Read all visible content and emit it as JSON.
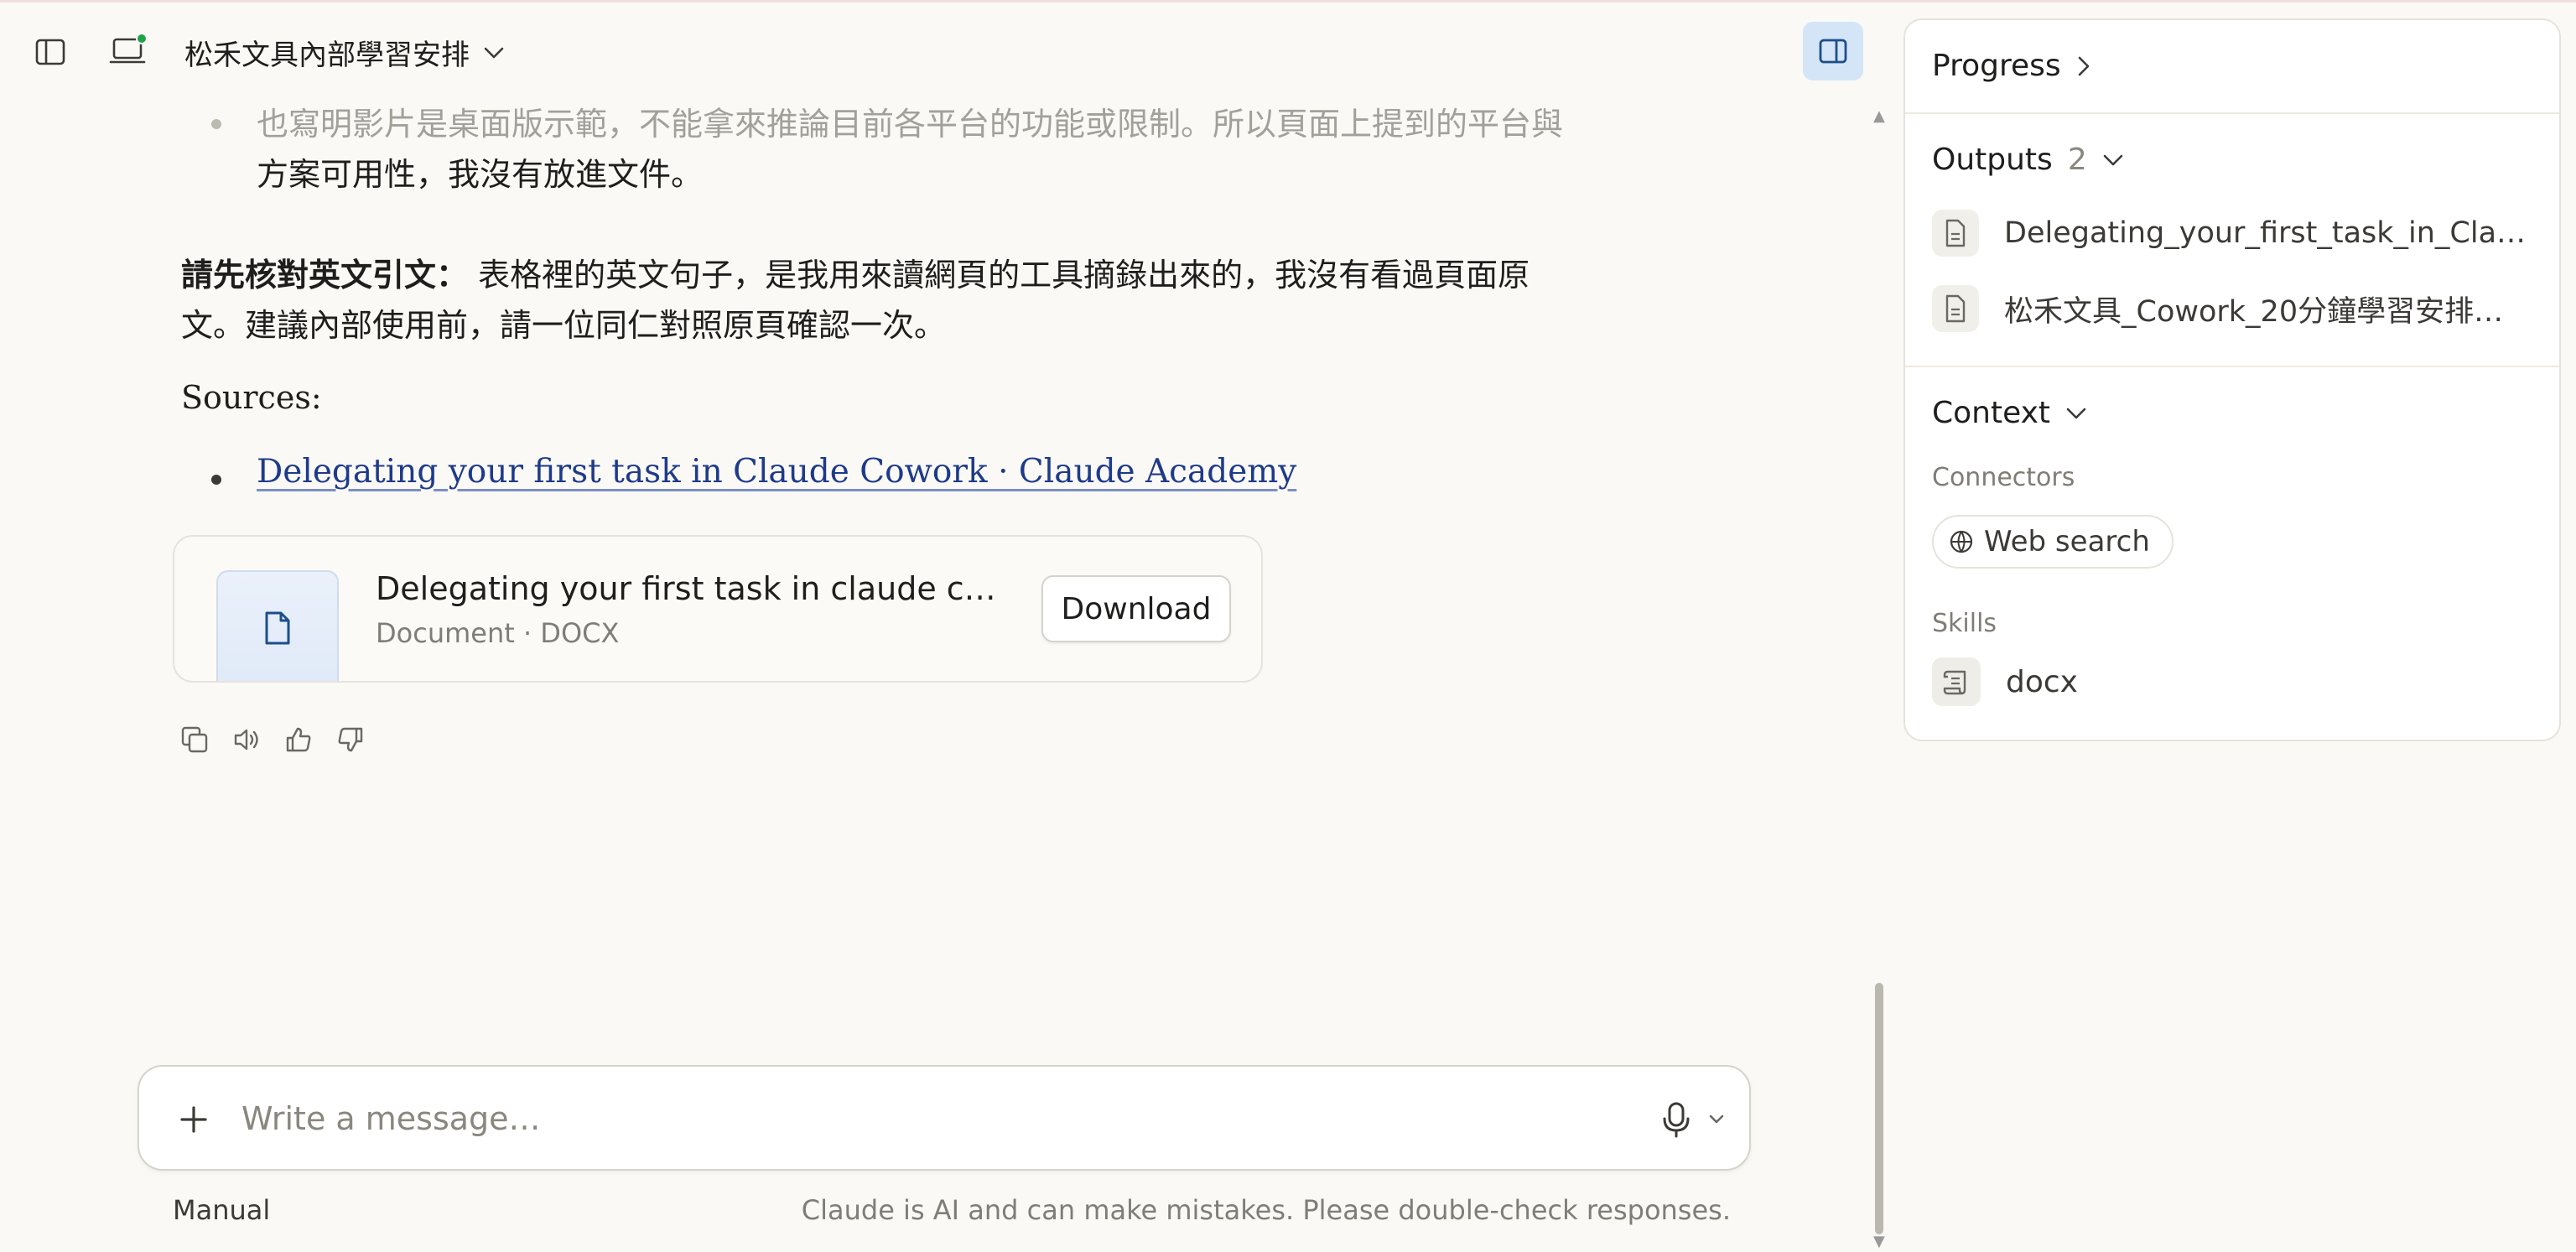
{
  "header": {
    "title": "松禾文具內部學習安排"
  },
  "message": {
    "bullet_prev": "也寫明影片是桌面版示範，不能拿來推論目前各平台的功能或限制。所以頁面上提到的平台與",
    "bullet_prev_cont": "方案可用性，我沒有放進文件。",
    "verify_bold": "請先核對英文引文：",
    "verify_text_line1": "表格裡的英文句子，是我用來讀網頁的工具摘錄出來的，我沒有看過頁面原",
    "verify_text_line2": "文。建議內部使用前，請一位同仁對照原頁確認一次。",
    "sources_label": "Sources:",
    "source_link": "Delegating your first task in Claude Cowork · Claude Academy"
  },
  "file_card": {
    "name": "Delegating your first task in claude cow…",
    "meta": "Document · DOCX",
    "download_label": "Download"
  },
  "composer": {
    "placeholder": "Write a message…",
    "mode_label": "Manual",
    "disclaimer": "Claude is AI and can make mistakes. Please double-check responses."
  },
  "panel": {
    "progress_label": "Progress",
    "outputs_label": "Outputs",
    "outputs_count": "2",
    "outputs": [
      "Delegating_your_first_task_in_Cla…",
      "松禾文具_Cowork_20分鐘學習安排…"
    ],
    "context_label": "Context",
    "connectors_label": "Connectors",
    "connector_web_search": "Web search",
    "skills_label": "Skills",
    "skill_docx": "docx"
  },
  "colors": {
    "background": "#faf9f5",
    "link": "#1e3a8a",
    "status_dot": "#1fa34a",
    "panel_toggle_bg": "#d4e5f8"
  }
}
